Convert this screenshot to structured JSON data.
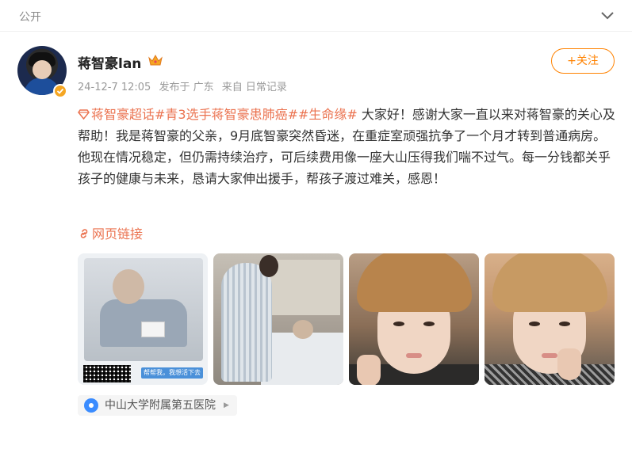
{
  "header": {
    "visibility": "公开"
  },
  "post": {
    "username": "蒋智豪lan",
    "meta": {
      "date": "24-12-7 12:05",
      "location_prefix": "发布于 广东",
      "source": "来自 日常记录"
    },
    "follow_label": "+关注",
    "hashtags": [
      "蒋智豪超话",
      "#青3选手蒋智豪患肺癌#",
      "#生命缘#"
    ],
    "text": " 大家好！感谢大家一直以来对蒋智豪的关心及帮助！我是蒋智豪的父亲，9月底智豪突然昏迷，在重症室顽强抗争了一个月才转到普通病房。他现在情况稳定，但仍需持续治疗，可后续费用像一座大山压得我们喘不过气。每一分钱都关乎孩子的健康与未来，恳请大家伸出援手，帮孩子渡过难关，感恩！",
    "web_link": "网页链接",
    "photos": [
      {
        "name": "hospital-bed-photo",
        "caption": "帮帮我，我想活下去"
      },
      {
        "name": "hospital-visit-photo"
      },
      {
        "name": "portrait-photo-1"
      },
      {
        "name": "portrait-photo-2"
      }
    ],
    "location_tag": "中山大学附属第五医院"
  },
  "icons": {
    "chevron": "chevron-down-icon",
    "verified": "verified-badge-icon",
    "crown": "crown-icon",
    "supertopic": "diamond-icon",
    "link": "link-icon",
    "pin": "location-pin-icon"
  },
  "colors": {
    "accent": "#ff8200",
    "tag": "#eb7350",
    "meta": "#9a9a9a",
    "pin": "#3b8cff"
  }
}
